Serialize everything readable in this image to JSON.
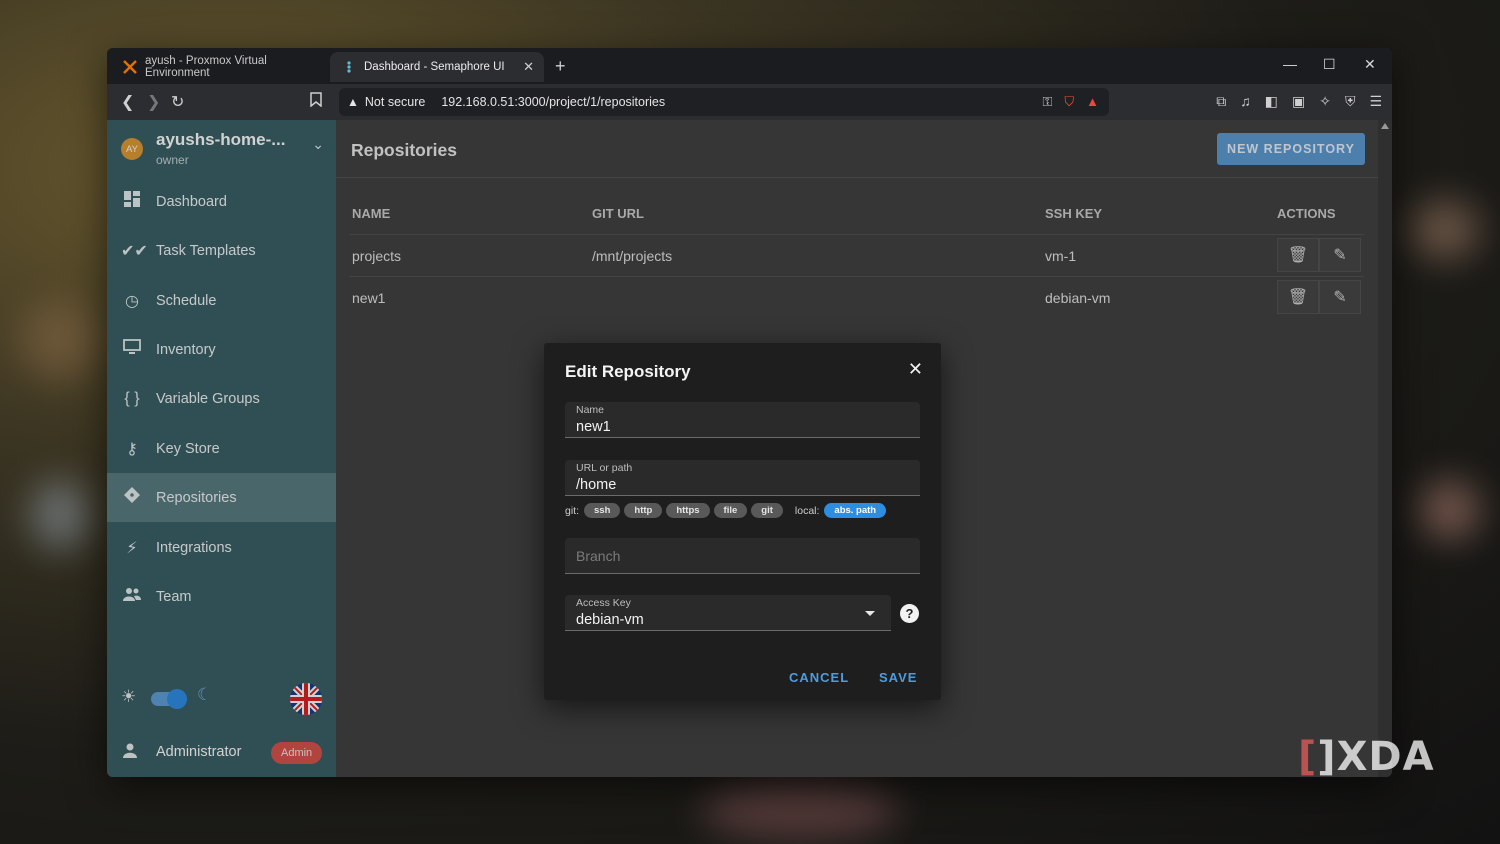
{
  "browser": {
    "tabs": [
      {
        "title": "ayush - Proxmox Virtual Environment"
      },
      {
        "title": "Dashboard - Semaphore UI"
      }
    ],
    "new_tab": "+",
    "security": "Not secure",
    "url": "192.168.0.51:3000/project/1/repositories",
    "icons": [
      "back-icon",
      "forward-icon",
      "reload-icon",
      "bookmark-icon",
      "key-icon",
      "brave-shield-icon",
      "rewards-icon"
    ]
  },
  "sidebar": {
    "project_avatar": "AY",
    "project_name": "ayushs-home-...",
    "project_role": "owner",
    "items": [
      {
        "label": "Dashboard",
        "icon": "dashboard-icon"
      },
      {
        "label": "Task Templates",
        "icon": "check-all-icon"
      },
      {
        "label": "Schedule",
        "icon": "clock-icon"
      },
      {
        "label": "Inventory",
        "icon": "monitor-icon"
      },
      {
        "label": "Variable Groups",
        "icon": "braces-icon"
      },
      {
        "label": "Key Store",
        "icon": "key-icon"
      },
      {
        "label": "Repositories",
        "icon": "git-icon"
      },
      {
        "label": "Integrations",
        "icon": "plug-icon"
      },
      {
        "label": "Team",
        "icon": "team-icon"
      }
    ],
    "active_item": "Repositories",
    "user_name": "Administrator",
    "user_badge": "Admin"
  },
  "main": {
    "title": "Repositories",
    "new_button": "NEW REPOSITORY",
    "columns": [
      "NAME",
      "GIT URL",
      "SSH KEY",
      "ACTIONS"
    ],
    "rows": [
      {
        "name": "projects",
        "git_url": "/mnt/projects",
        "ssh_key": "vm-1"
      },
      {
        "name": "new1",
        "git_url": "",
        "ssh_key": "debian-vm"
      }
    ]
  },
  "dialog": {
    "title": "Edit Repository",
    "name_label": "Name",
    "name_value": "new1",
    "url_label": "URL or path",
    "url_value": "/home",
    "git_prefix": "git:",
    "git_chips": [
      "ssh",
      "http",
      "https",
      "file",
      "git"
    ],
    "local_prefix": "local:",
    "local_chip": "abs. path",
    "branch_placeholder": "Branch",
    "access_key_label": "Access Key",
    "access_key_value": "debian-vm",
    "help": "?",
    "cancel": "CANCEL",
    "save": "SAVE"
  },
  "colors": {
    "sidebar": "#3b6168",
    "sidebar_active": "#5a7d83",
    "primary": "#5e9bd3",
    "badge": "#d9534f"
  }
}
